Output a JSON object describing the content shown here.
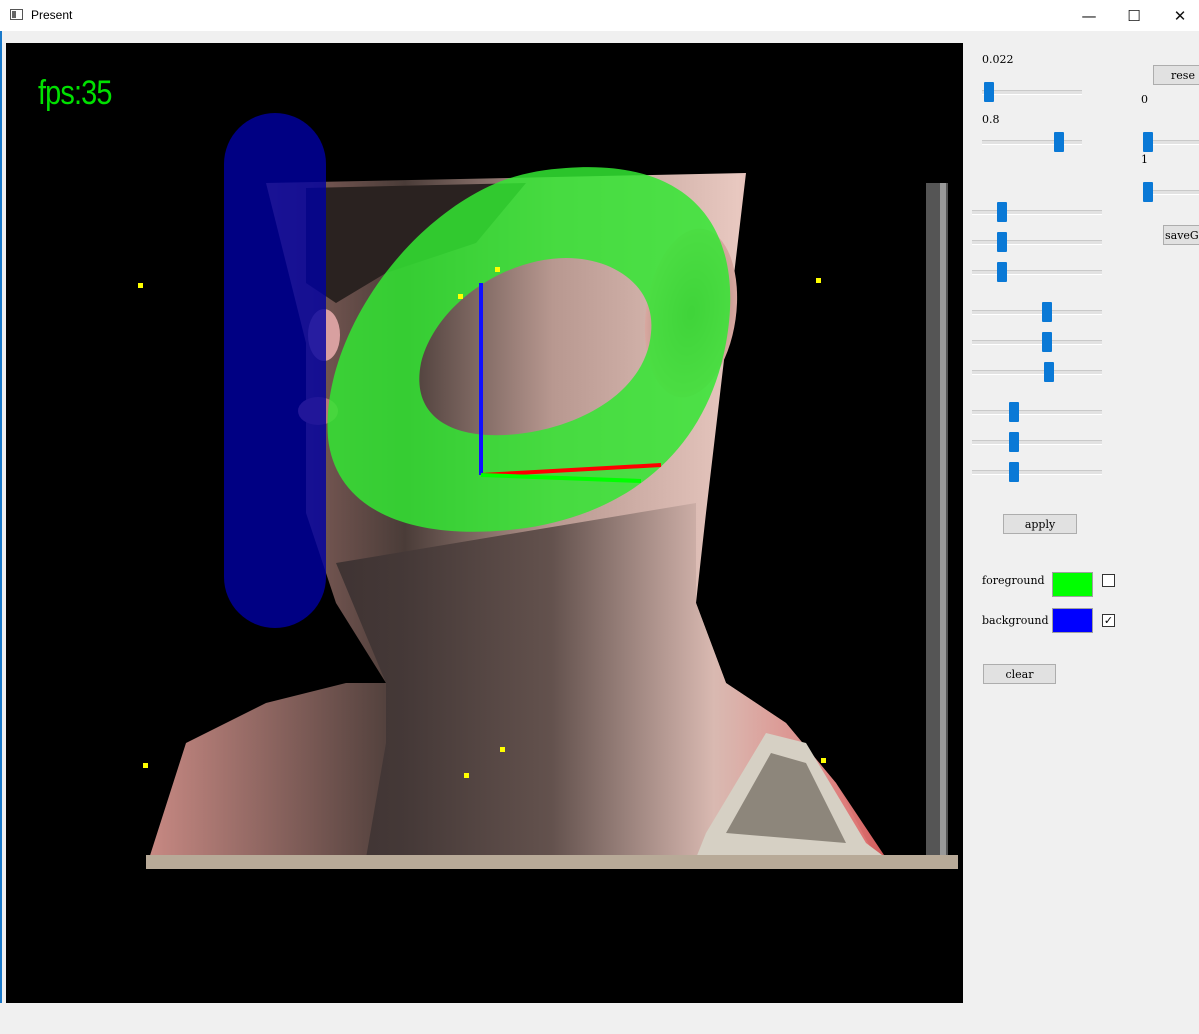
{
  "window": {
    "title": "Present",
    "icons": {
      "app": "window-app-icon",
      "minimize": "minimize-icon",
      "maximize": "maximize-icon",
      "close": "close-icon"
    },
    "glyphs": {
      "minimize": "—",
      "maximize": "☐",
      "close": "✕"
    }
  },
  "viewport": {
    "fps_label": "fps:35",
    "colors": {
      "background": "#000000",
      "fps_text": "#00e000",
      "foreground_mask": "#33e633",
      "background_mask": "#0000a0",
      "axis_x": "#ff0000",
      "axis_y": "#00ff00",
      "axis_z": "#0000ff",
      "marker": "#ffff00"
    },
    "marker_count": 8
  },
  "panel": {
    "value_labels": [
      "0.022",
      "0.8",
      "0",
      "1"
    ],
    "sliders": [
      {
        "id": "slider-opacity",
        "value": 0.05
      },
      {
        "id": "slider-threshold",
        "value": 0.8
      },
      {
        "id": "slider-right-a",
        "value": 0.0
      },
      {
        "id": "slider-right-b",
        "value": 0.0
      },
      {
        "id": "slider-rot-x-1",
        "value": 0.22
      },
      {
        "id": "slider-rot-x-2",
        "value": 0.22
      },
      {
        "id": "slider-rot-x-3",
        "value": 0.22
      },
      {
        "id": "slider-rot-y-1",
        "value": 0.58
      },
      {
        "id": "slider-rot-y-2",
        "value": 0.58
      },
      {
        "id": "slider-rot-y-3",
        "value": 0.6
      },
      {
        "id": "slider-rot-z-1",
        "value": 0.31
      },
      {
        "id": "slider-rot-z-2",
        "value": 0.31
      },
      {
        "id": "slider-rot-z-3",
        "value": 0.31
      }
    ],
    "buttons": {
      "reset": "rese",
      "save": "saveGr",
      "apply": "apply",
      "clear": "clear"
    },
    "foreground": {
      "label": "foreground",
      "color": "#00ff00",
      "checked": false
    },
    "background": {
      "label": "background",
      "color": "#0000ff",
      "checked": true
    },
    "checkmark": "✓"
  }
}
